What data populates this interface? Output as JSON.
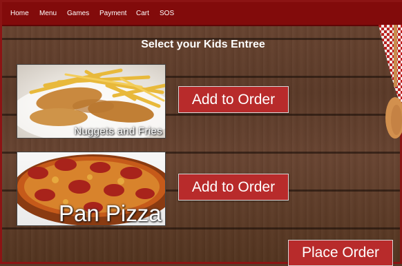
{
  "nav": {
    "items": [
      {
        "label": "Home"
      },
      {
        "label": "Menu"
      },
      {
        "label": "Games"
      },
      {
        "label": "Payment"
      },
      {
        "label": "Cart"
      },
      {
        "label": "SOS"
      }
    ]
  },
  "page": {
    "title": "Select your Kids Entree"
  },
  "items": [
    {
      "name": "Nuggets and Fries",
      "button_label": "Add to Order"
    },
    {
      "name": "Pan Pizza",
      "button_label": "Add to Order"
    }
  ],
  "order": {
    "place_label": "Place Order"
  },
  "colors": {
    "nav_bg": "#820b0b",
    "button_bg": "#b82b2b",
    "wood": "#5b3a28"
  }
}
